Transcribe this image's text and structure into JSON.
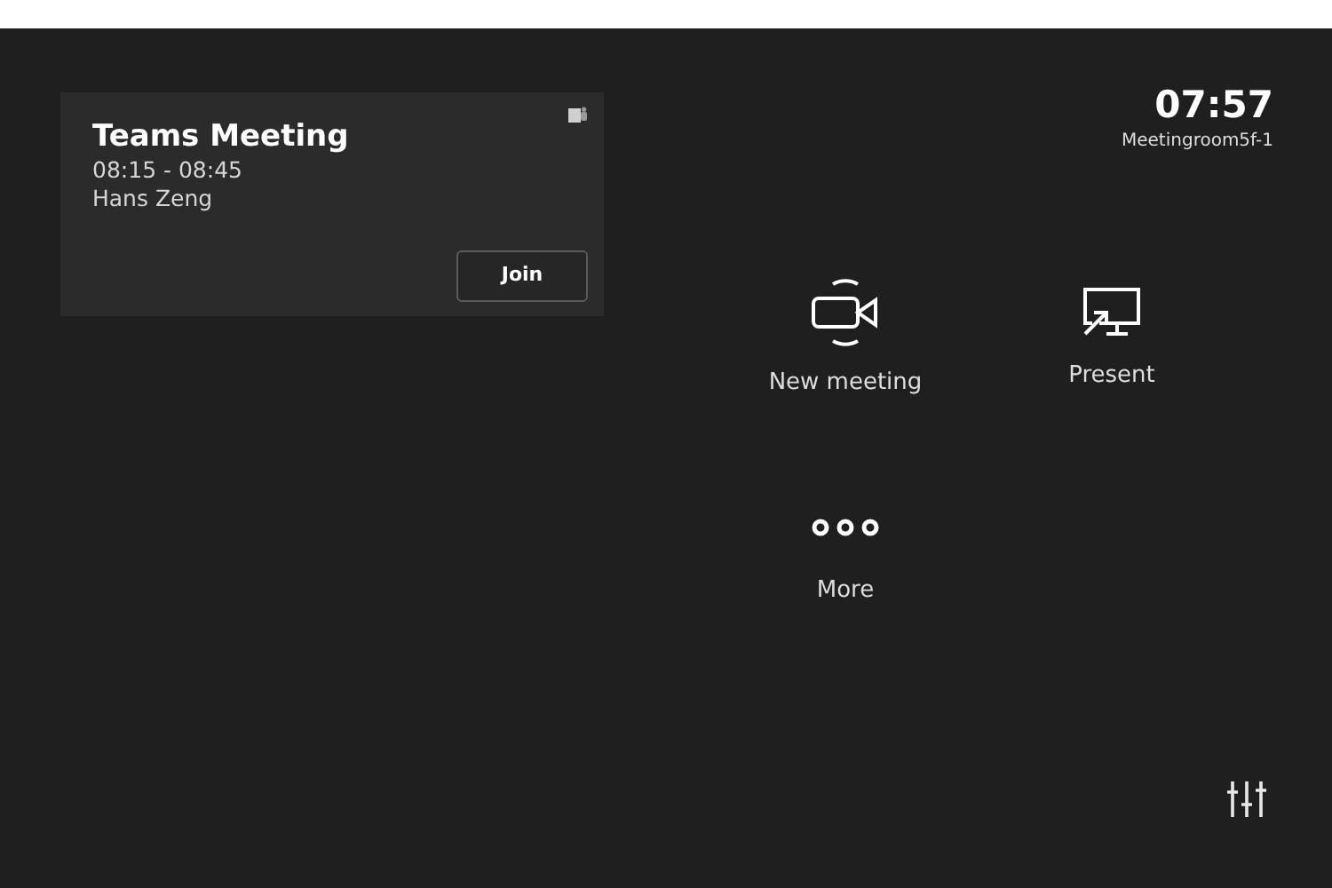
{
  "meeting": {
    "title": "Teams Meeting",
    "time": "08:15 - 08:45",
    "organizer": "Hans Zeng",
    "join": "Join"
  },
  "clock": {
    "time": "07:57",
    "room": "Meetingroom5f-1"
  },
  "actions": [
    {
      "kind": "camera",
      "label": "New meeting"
    },
    {
      "kind": "present",
      "label": "Present"
    },
    {
      "kind": "more",
      "label": "More"
    }
  ]
}
